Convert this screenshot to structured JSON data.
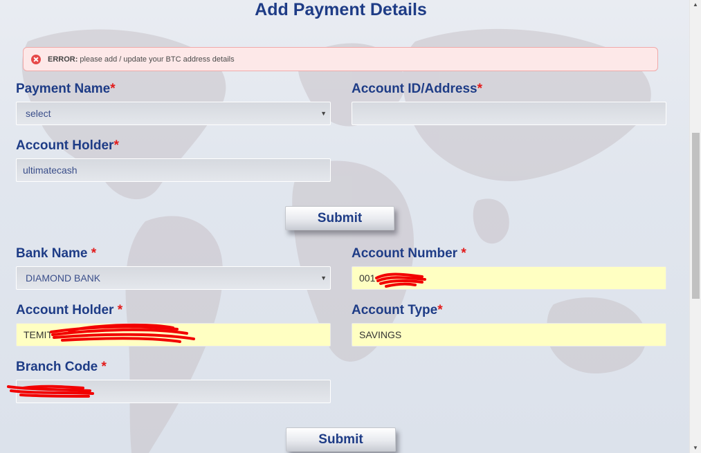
{
  "page": {
    "title": "Add Payment Details"
  },
  "alert": {
    "label": "ERROR:",
    "message": "please add / update your BTC address details",
    "icon": "error-circle-x-icon",
    "color": "#e64848"
  },
  "crypto_form": {
    "payment_name_label": "Payment Name",
    "payment_name_value": "select",
    "account_id_label": "Account ID/Address",
    "account_id_value": "",
    "account_holder_label": "Account Holder",
    "account_holder_value": "ultimatecash",
    "submit_label": "Submit"
  },
  "bank_form": {
    "bank_name_label": "Bank Name ",
    "bank_name_value": "DIAMOND BANK",
    "account_number_label": "Account Number ",
    "account_number_value": "001",
    "account_holder_label": "Account Holder ",
    "account_holder_value": "TEMIT",
    "account_type_label": "Account Type",
    "account_type_value": "SAVINGS",
    "branch_code_label": "Branch Code ",
    "branch_code_value": "",
    "submit_label": "Submit"
  },
  "required_marker": "*",
  "colors": {
    "heading": "#1e3c86",
    "required": "#e21b1b",
    "autofill": "#ffffc2",
    "redaction": "#f20000"
  }
}
